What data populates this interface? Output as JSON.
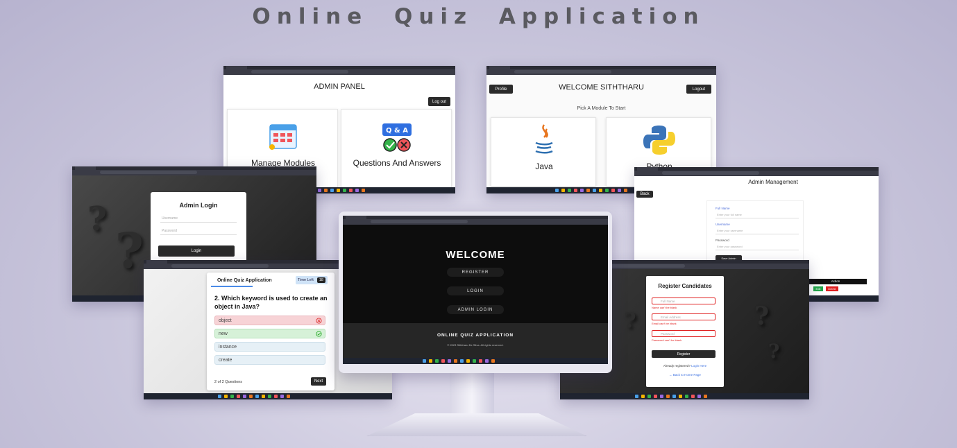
{
  "title": "Online Quiz Application",
  "admin_panel": {
    "heading": "ADMIN PANEL",
    "logout": "Log out",
    "card1": "Manage Modules",
    "card2": "Questions And Answers",
    "qa_label": "Q & A"
  },
  "candidate_home": {
    "heading": "WELCOME SITHTHARU",
    "profile": "Profile",
    "logout": "Logout",
    "subheading": "Pick A Module To Start",
    "module1": "Java",
    "module2": "Python"
  },
  "admin_login": {
    "heading": "Admin Login",
    "username_placeholder": "Username",
    "password_placeholder": "Password",
    "login": "Login"
  },
  "admin_management": {
    "heading": "Admin Management",
    "back": "Back",
    "fullname_label": "Full Name",
    "fullname_placeholder": "Enter your full name",
    "username_label": "Username",
    "username_placeholder": "Enter your username",
    "password_label": "Password",
    "password_placeholder": "Enter your password",
    "save": "Save Admin",
    "action": "Action",
    "edit": "Edit",
    "delete": "Delete"
  },
  "quiz": {
    "app_title": "Online Quiz Application",
    "time_label": "Time Left",
    "time_value": "18",
    "question": "2. Which keyword is used to create an object in Java?",
    "options": [
      "object",
      "new",
      "instance",
      "create"
    ],
    "progress": "2 of 2 Questions",
    "next": "Next"
  },
  "welcome": {
    "heading": "WELCOME",
    "register": "REGISTER",
    "login": "LOGIN",
    "admin_login": "ADMIN LOGIN",
    "footer_title": "ONLINE QUIZ APPLICATION",
    "footer_copy": "© 2023 Siththaru De Silva. All rights reserved."
  },
  "register": {
    "heading": "Register Candidates",
    "fullname_placeholder": "Full Name",
    "fullname_error": "Name can't be blank",
    "email_placeholder": "Email Address",
    "email_error": "Email can't be blank",
    "password_placeholder": "Password",
    "password_error": "Password can't be blank",
    "register": "Register",
    "already": "Already registered?",
    "login_here": "Login Here",
    "back": "← Back to Home Page"
  },
  "colors": {
    "background": "#c9c6dc",
    "title": "#5a5a60",
    "correct": "#d6f1d8",
    "wrong": "#f7d3d6",
    "neutral": "#e6f0f6",
    "error": "#e02020"
  }
}
